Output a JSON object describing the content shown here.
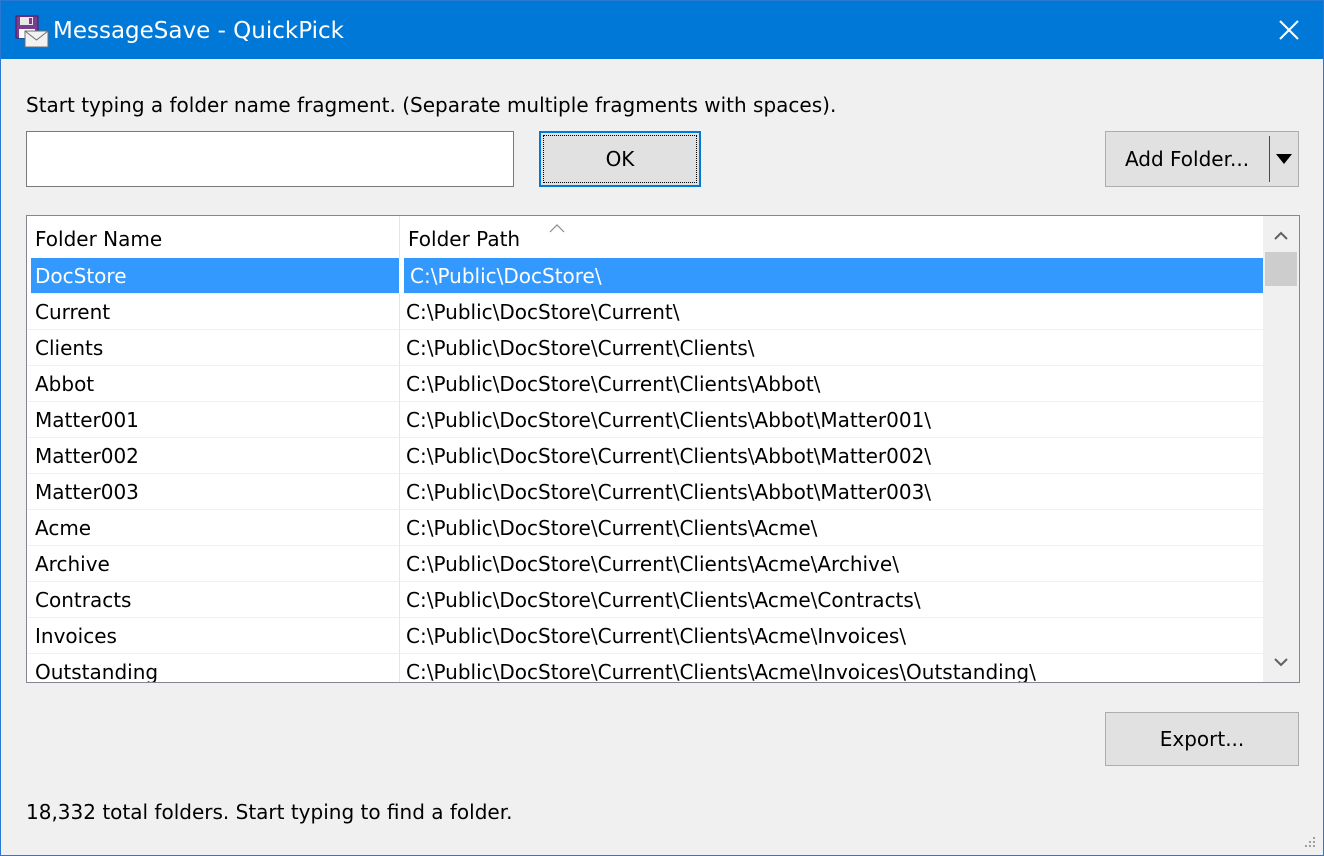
{
  "window": {
    "title": "MessageSave - QuickPick",
    "app_icon": "floppy-envelope-icon",
    "close_icon": "close-icon",
    "accent_color": "#0078d7"
  },
  "prompt": {
    "instruction": "Start typing a folder name fragment. (Separate multiple fragments with spaces).",
    "search_value": "",
    "ok_label": "OK",
    "add_folder_label": "Add Folder..."
  },
  "list": {
    "columns": [
      "Folder Name",
      "Folder Path"
    ],
    "sort_icon": "sort-ascending-icon",
    "selected_index": 0,
    "selection_color": "#3399ff",
    "rows": [
      {
        "name": "DocStore",
        "path": "C:\\Public\\DocStore\\"
      },
      {
        "name": "Current",
        "path": "C:\\Public\\DocStore\\Current\\"
      },
      {
        "name": "Clients",
        "path": "C:\\Public\\DocStore\\Current\\Clients\\"
      },
      {
        "name": "Abbot",
        "path": "C:\\Public\\DocStore\\Current\\Clients\\Abbot\\"
      },
      {
        "name": "Matter001",
        "path": "C:\\Public\\DocStore\\Current\\Clients\\Abbot\\Matter001\\"
      },
      {
        "name": "Matter002",
        "path": "C:\\Public\\DocStore\\Current\\Clients\\Abbot\\Matter002\\"
      },
      {
        "name": "Matter003",
        "path": "C:\\Public\\DocStore\\Current\\Clients\\Abbot\\Matter003\\"
      },
      {
        "name": "Acme",
        "path": "C:\\Public\\DocStore\\Current\\Clients\\Acme\\"
      },
      {
        "name": "Archive",
        "path": "C:\\Public\\DocStore\\Current\\Clients\\Acme\\Archive\\"
      },
      {
        "name": "Contracts",
        "path": "C:\\Public\\DocStore\\Current\\Clients\\Acme\\Contracts\\"
      },
      {
        "name": "Invoices",
        "path": "C:\\Public\\DocStore\\Current\\Clients\\Acme\\Invoices\\"
      },
      {
        "name": "Outstanding",
        "path": "C:\\Public\\DocStore\\Current\\Clients\\Acme\\Invoices\\Outstanding\\"
      }
    ]
  },
  "footer": {
    "export_label": "Export...",
    "status": "18,332 total folders. Start typing to find a folder."
  }
}
